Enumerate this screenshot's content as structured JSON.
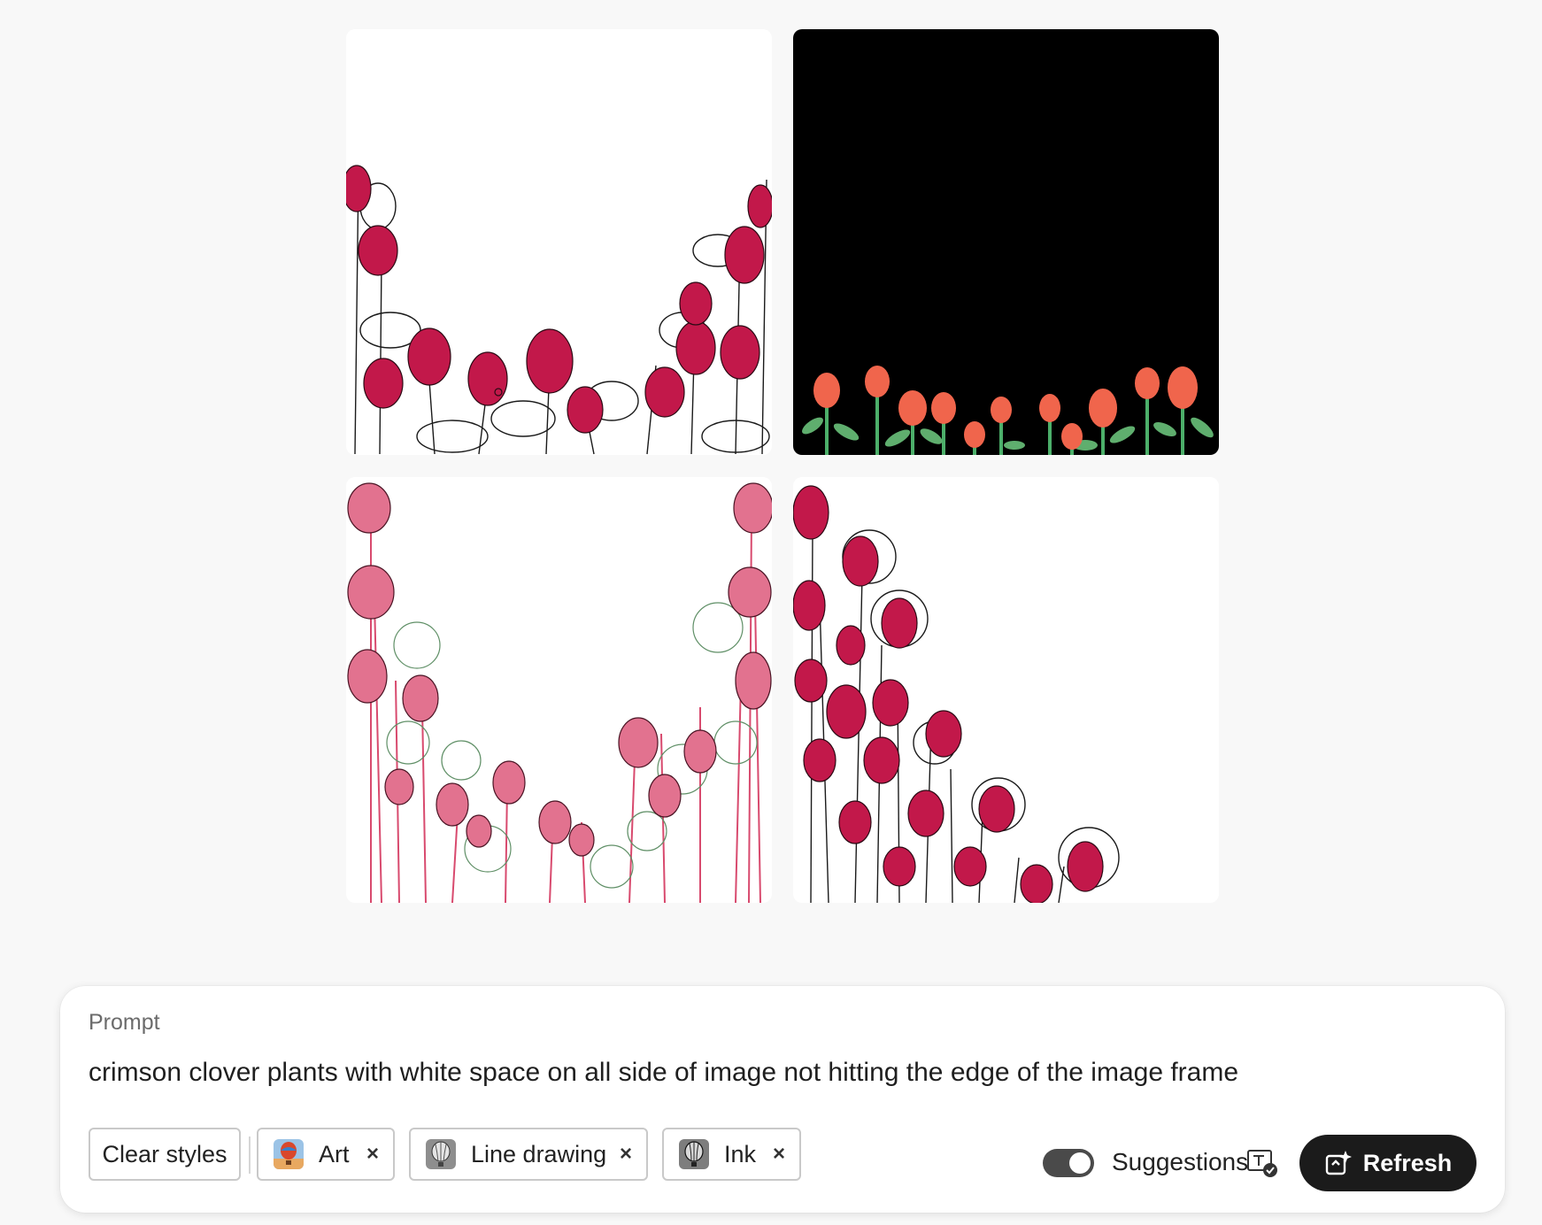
{
  "prompt": {
    "label": "Prompt",
    "text": "crimson clover plants with white space on all side of image not hitting the edge of the image frame"
  },
  "styles": {
    "clear_label": "Clear styles",
    "chips": [
      {
        "label": "Art",
        "icon": "hot-air-balloon-color-thumbnail"
      },
      {
        "label": "Line drawing",
        "icon": "hot-air-balloon-sketch-thumbnail"
      },
      {
        "label": "Ink",
        "icon": "hot-air-balloon-ink-thumbnail"
      }
    ],
    "remove_icon": "×"
  },
  "suggestions": {
    "label": "Suggestions",
    "enabled": true
  },
  "refresh": {
    "label": "Refresh"
  },
  "images": [
    {
      "style": "ink clover on white"
    },
    {
      "style": "colored clover on black"
    },
    {
      "style": "pink clover with green leaves"
    },
    {
      "style": "clover corner cluster"
    }
  ],
  "colors": {
    "crimson": "#c2184a",
    "dark_button": "#1b1b1b",
    "toggle_on": "#4a4a4a"
  }
}
